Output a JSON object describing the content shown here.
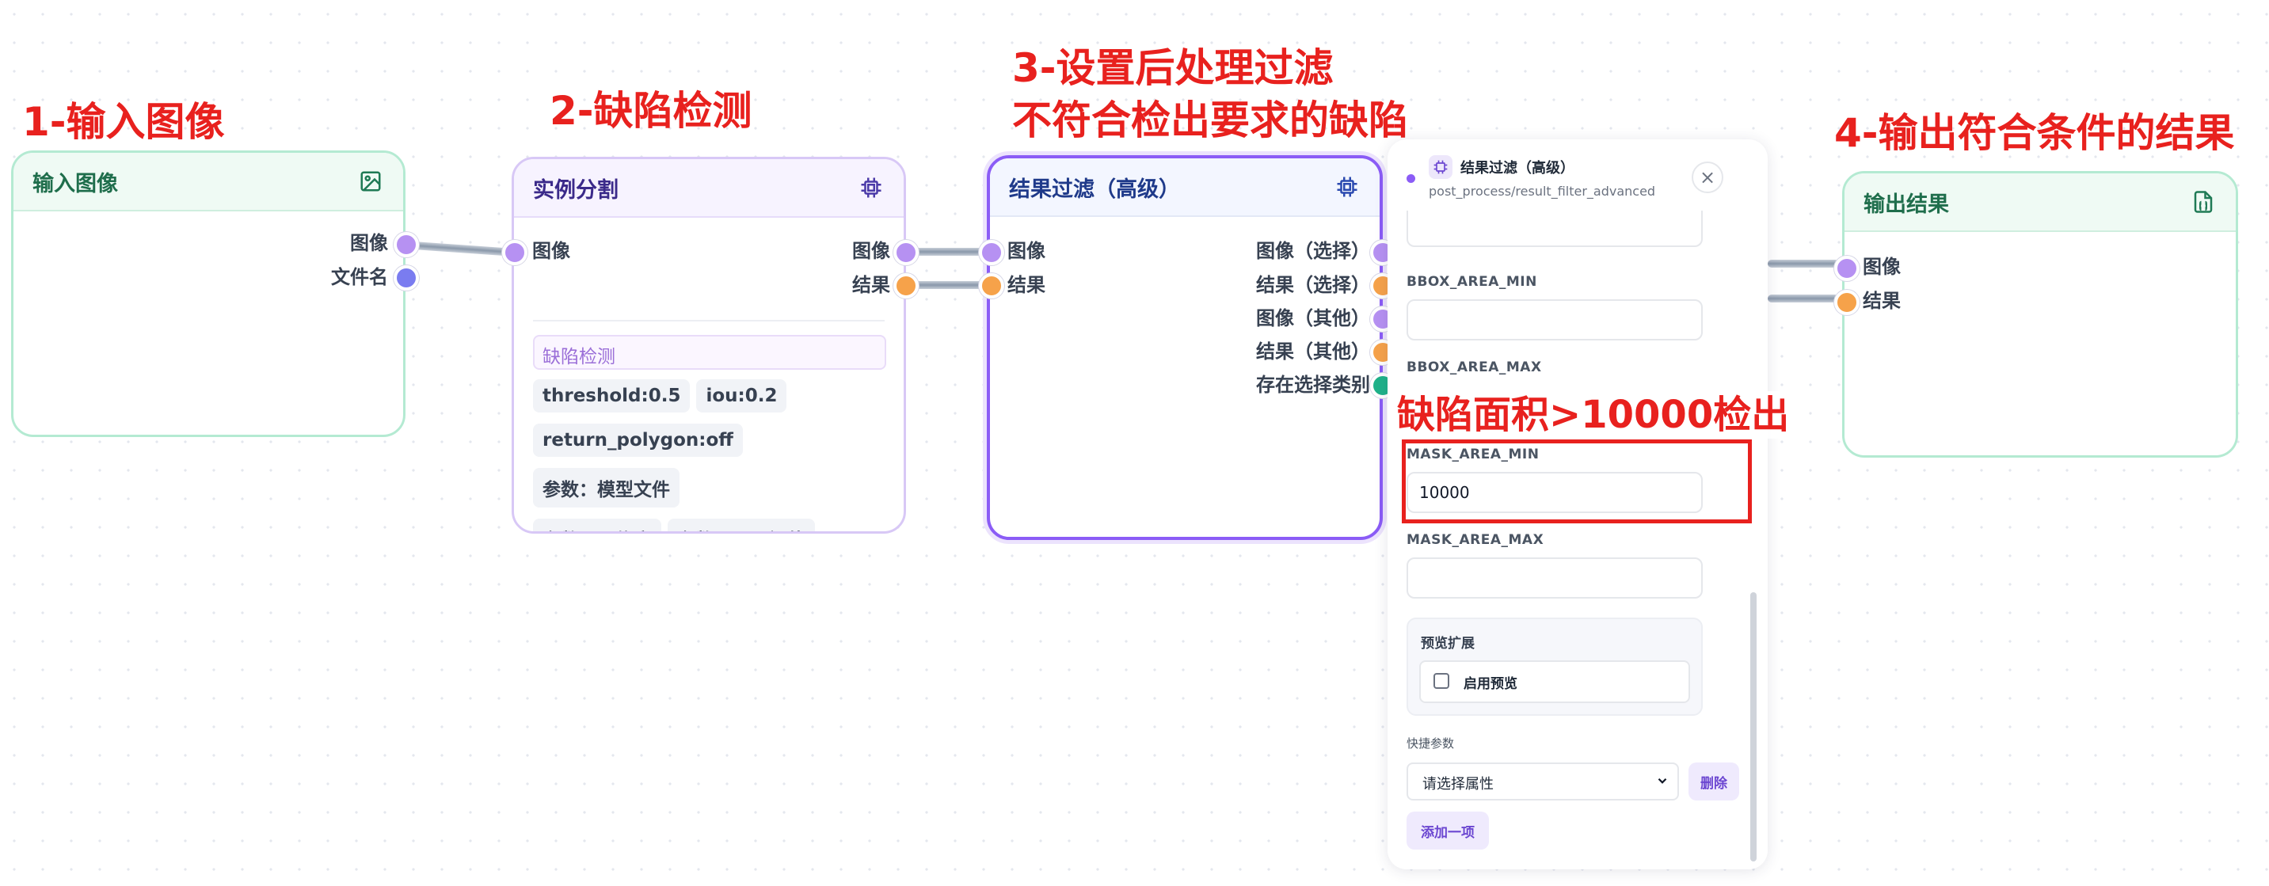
{
  "annotations": {
    "step1": "1-输入图像",
    "step2": "2-缺陷检测",
    "step3_line1": "3-设置后处理过滤",
    "step3_line2": "不符合检出要求的缺陷",
    "step4": "4-输出符合条件的结果",
    "mask_note": "缺陷面积>10000检出"
  },
  "colors": {
    "annotation_red": "#e8211e",
    "input_node_border": "#b4ead2",
    "input_node_header": "#effaf4",
    "segment_node_border": "#d8c8f6",
    "filter_node_border": "#8b5cf6",
    "output_node_border": "#b4ead2"
  },
  "input_node": {
    "title": "输入图像",
    "icon": "image-icon",
    "outputs": [
      "图像",
      "文件名"
    ]
  },
  "segment_node": {
    "title": "实例分割",
    "icon": "chip-icon",
    "inputs": [
      "图像"
    ],
    "outputs": [
      "图像",
      "结果"
    ],
    "model_tag": "缺陷检测",
    "chips": [
      "threshold:0.5",
      "iou:0.2",
      "return_polygon:off",
      "参数：模型文件",
      "参数：置信度",
      "参数：IOU阈值"
    ]
  },
  "filter_node": {
    "title": "结果过滤（高级）",
    "icon": "chip-icon",
    "inputs": [
      "图像",
      "结果"
    ],
    "outputs": [
      "图像（选择）",
      "结果（选择）",
      "图像（其他）",
      "结果（其他）",
      "存在选择类别"
    ]
  },
  "output_node": {
    "title": "输出结果",
    "icon": "json-file-icon",
    "inputs": [
      "图像",
      "结果"
    ]
  },
  "panel": {
    "title": "结果过滤（高级）",
    "subtitle": "post_process/result_filter_advanced",
    "close": "×",
    "fields": [
      {
        "label": "BBOX_AREA_MIN",
        "value": ""
      },
      {
        "label": "BBOX_AREA_MAX",
        "value": ""
      },
      {
        "label": "MASK_AREA_MIN",
        "value": "10000"
      },
      {
        "label": "MASK_AREA_MAX",
        "value": ""
      }
    ],
    "preview_section": "预览扩展",
    "preview_checkbox": "启用预览",
    "quick_params_label": "快捷参数",
    "select_placeholder": "请选择属性",
    "delete_button": "删除",
    "add_button": "添加一项"
  }
}
